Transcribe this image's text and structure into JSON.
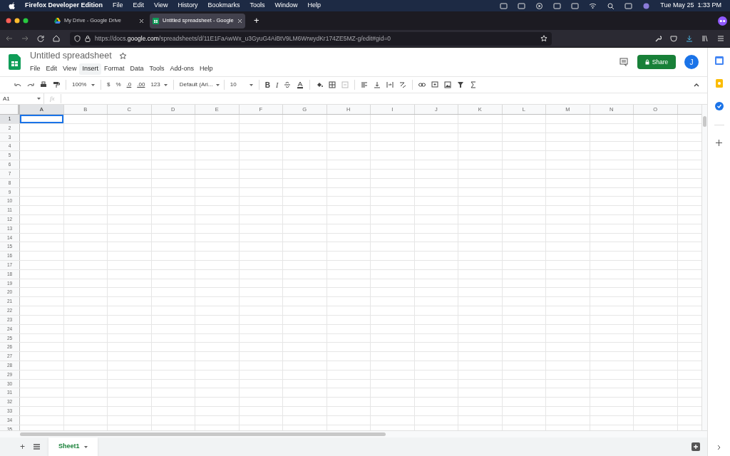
{
  "menu_bar": {
    "app": "Firefox Developer Edition",
    "items": [
      "File",
      "Edit",
      "View",
      "History",
      "Bookmarks",
      "Tools",
      "Window",
      "Help"
    ],
    "clock": "Tue May 25  1:33 PM"
  },
  "tabs": [
    {
      "title": "My Drive - Google Drive",
      "selected": false
    },
    {
      "title": "Untitled spreadsheet - Google",
      "selected": true
    }
  ],
  "new_tab": "+",
  "url": {
    "prefix": "https://docs.",
    "domain": "google.com",
    "path": "/spreadsheets/d/11E1FaAwWx_u3GyuG4AiBtV9LM6WrwydKr174ZE5MZ-g/edit#gid=0"
  },
  "doc": {
    "title": "Untitled spreadsheet",
    "menus": [
      {
        "label": "File",
        "highlighted": false
      },
      {
        "label": "Edit",
        "highlighted": false
      },
      {
        "label": "View",
        "highlighted": false
      },
      {
        "label": "Insert",
        "highlighted": true
      },
      {
        "label": "Format",
        "highlighted": false
      },
      {
        "label": "Data",
        "highlighted": false
      },
      {
        "label": "Tools",
        "highlighted": false
      },
      {
        "label": "Add-ons",
        "highlighted": false
      },
      {
        "label": "Help",
        "highlighted": false
      }
    ],
    "share": "Share",
    "avatar": "J"
  },
  "toolbar": {
    "zoom": "100%",
    "currency": "$",
    "percent": "%",
    "decrease_decimals": ".0",
    "increase_decimals": ".00",
    "more_formats": "123",
    "font": "Default (Ari...",
    "font_size": "10",
    "bold": "B",
    "italic": "I"
  },
  "formula_bar": {
    "cell": "A1",
    "fx": "fx"
  },
  "grid": {
    "columns": [
      {
        "label": "A",
        "selected": true
      },
      {
        "label": "B",
        "selected": false
      },
      {
        "label": "C",
        "selected": false
      },
      {
        "label": "D",
        "selected": false
      },
      {
        "label": "E",
        "selected": false
      },
      {
        "label": "F",
        "selected": false
      },
      {
        "label": "G",
        "selected": false
      },
      {
        "label": "H",
        "selected": false
      },
      {
        "label": "I",
        "selected": false
      },
      {
        "label": "J",
        "selected": false
      },
      {
        "label": "K",
        "selected": false
      },
      {
        "label": "L",
        "selected": false
      },
      {
        "label": "M",
        "selected": false
      },
      {
        "label": "N",
        "selected": false
      },
      {
        "label": "O",
        "selected": false
      }
    ],
    "rows": [
      {
        "label": "1",
        "selected": true
      },
      {
        "label": "2",
        "selected": false
      },
      {
        "label": "3",
        "selected": false
      },
      {
        "label": "4",
        "selected": false
      },
      {
        "label": "5",
        "selected": false
      },
      {
        "label": "6",
        "selected": false
      },
      {
        "label": "7",
        "selected": false
      },
      {
        "label": "8",
        "selected": false
      },
      {
        "label": "9",
        "selected": false
      },
      {
        "label": "10",
        "selected": false
      },
      {
        "label": "11",
        "selected": false
      },
      {
        "label": "12",
        "selected": false
      },
      {
        "label": "13",
        "selected": false
      },
      {
        "label": "14",
        "selected": false
      },
      {
        "label": "15",
        "selected": false
      },
      {
        "label": "16",
        "selected": false
      },
      {
        "label": "17",
        "selected": false
      },
      {
        "label": "18",
        "selected": false
      },
      {
        "label": "19",
        "selected": false
      },
      {
        "label": "20",
        "selected": false
      },
      {
        "label": "21",
        "selected": false
      },
      {
        "label": "22",
        "selected": false
      },
      {
        "label": "23",
        "selected": false
      },
      {
        "label": "24",
        "selected": false
      },
      {
        "label": "25",
        "selected": false
      },
      {
        "label": "26",
        "selected": false
      },
      {
        "label": "27",
        "selected": false
      },
      {
        "label": "28",
        "selected": false
      },
      {
        "label": "29",
        "selected": false
      },
      {
        "label": "30",
        "selected": false
      },
      {
        "label": "31",
        "selected": false
      },
      {
        "label": "32",
        "selected": false
      },
      {
        "label": "33",
        "selected": false
      },
      {
        "label": "34",
        "selected": false
      },
      {
        "label": "35",
        "selected": false
      }
    ]
  },
  "sheet_tabs": [
    {
      "label": "Sheet1",
      "selected": true
    }
  ],
  "add_sheet": "+"
}
